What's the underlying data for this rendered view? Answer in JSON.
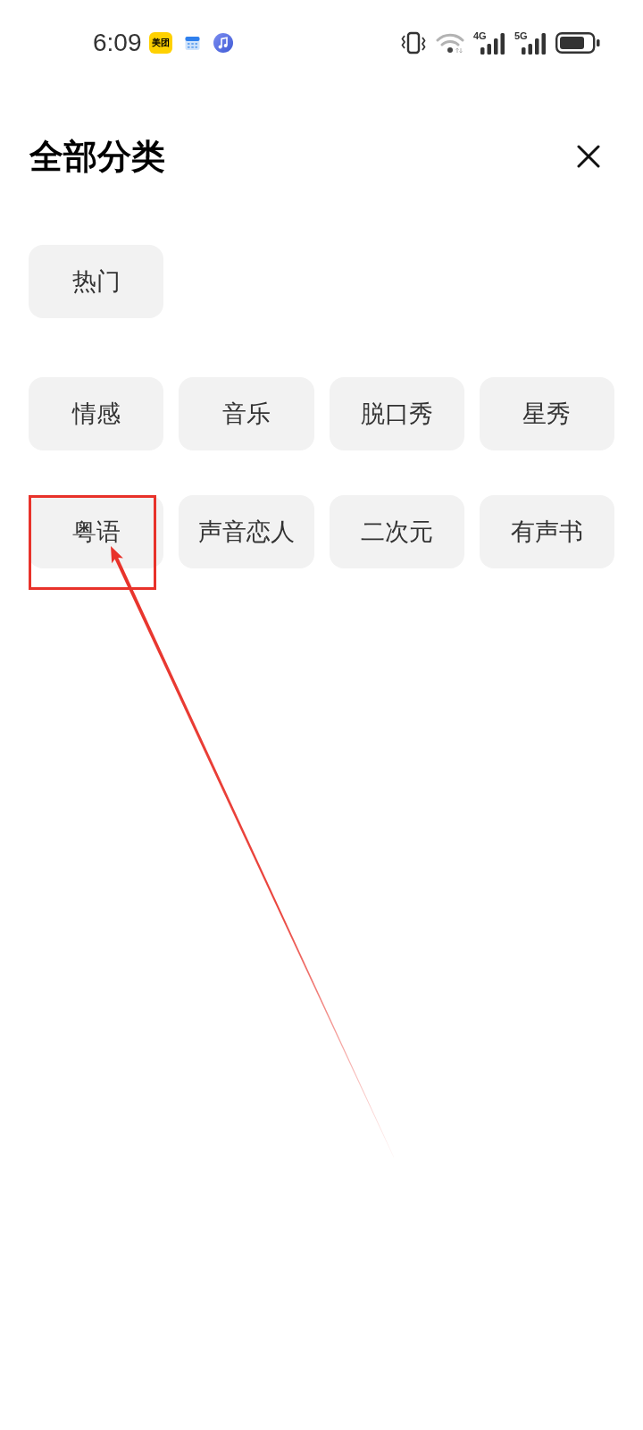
{
  "status_bar": {
    "time": "6:09",
    "notification_icons": [
      {
        "kind": "text_tile",
        "label": "美团"
      },
      {
        "kind": "calendar"
      },
      {
        "kind": "music"
      }
    ],
    "system_icons": [
      {
        "kind": "vibrate"
      },
      {
        "kind": "wifi"
      },
      {
        "kind": "signal",
        "label": "4G"
      },
      {
        "kind": "signal",
        "label": "5G"
      },
      {
        "kind": "battery"
      }
    ]
  },
  "header": {
    "title": "全部分类"
  },
  "sections": [
    {
      "items": [
        {
          "label": "热门",
          "annotated": false
        }
      ]
    },
    {
      "items": [
        {
          "label": "情感",
          "annotated": false
        },
        {
          "label": "音乐",
          "annotated": false
        },
        {
          "label": "脱口秀",
          "annotated": false
        },
        {
          "label": "星秀",
          "annotated": false
        },
        {
          "label": "粤语",
          "annotated": true
        },
        {
          "label": "声音恋人",
          "annotated": false
        },
        {
          "label": "二次元",
          "annotated": false
        },
        {
          "label": "有声书",
          "annotated": false
        }
      ]
    }
  ]
}
